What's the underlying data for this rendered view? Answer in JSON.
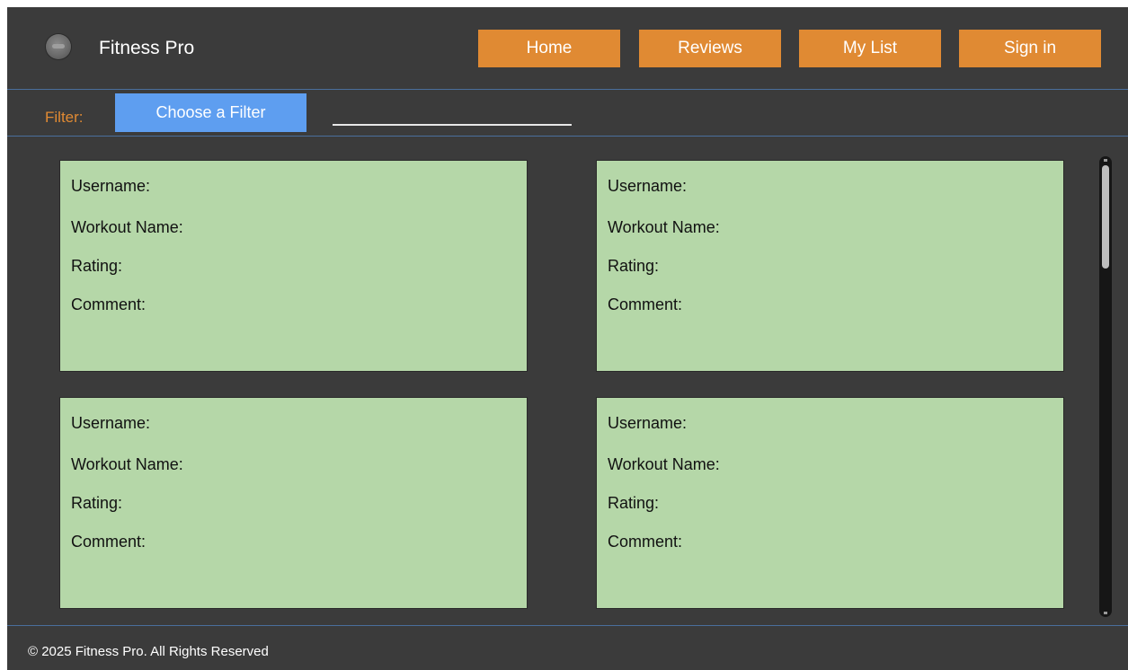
{
  "header": {
    "app_title": "Fitness Pro",
    "logo_icon": "logo-badge-icon",
    "nav": {
      "home": "Home",
      "reviews": "Reviews",
      "my_list": "My List",
      "sign_in": "Sign in"
    }
  },
  "filter": {
    "label": "Filter:",
    "button_label": "Choose a Filter",
    "input_value": ""
  },
  "reviews": [
    {
      "username": "Username:",
      "workout_name": "Workout Name:",
      "rating": "Rating:",
      "comment": "Comment:"
    },
    {
      "username": "Username:",
      "workout_name": "Workout Name:",
      "rating": "Rating:",
      "comment": "Comment:"
    },
    {
      "username": "Username:",
      "workout_name": "Workout Name:",
      "rating": "Rating:",
      "comment": "Comment:"
    },
    {
      "username": "Username:",
      "workout_name": "Workout Name:",
      "rating": "Rating:",
      "comment": "Comment:"
    }
  ],
  "footer": {
    "copyright": "© 2025 Fitness Pro. All Rights Reserved"
  },
  "colors": {
    "background": "#3b3b3b",
    "nav_button": "#e08a33",
    "filter_button": "#5e9ef0",
    "card": "#b5d7a8",
    "separator": "#4a6e9c"
  }
}
